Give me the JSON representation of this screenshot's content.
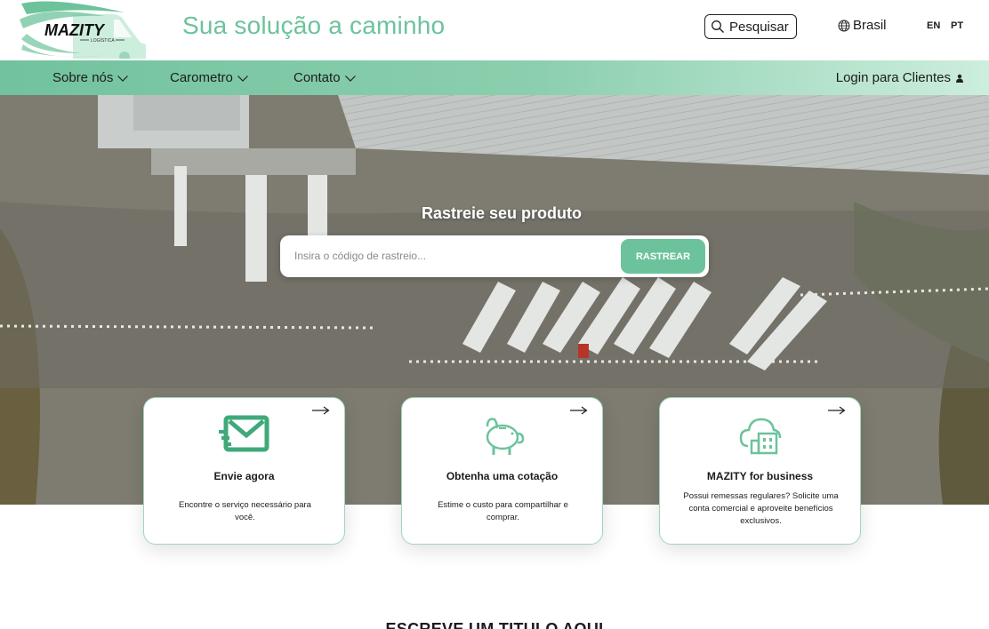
{
  "header": {
    "logo_text": "MAZITY",
    "logo_subtext": "LOGÍSTICA",
    "tagline": "Sua solução a caminho",
    "search_label": "Pesquisar",
    "region_label": "Brasil",
    "languages": [
      "EN",
      "PT"
    ]
  },
  "nav": {
    "items": [
      {
        "label": "Sobre nós"
      },
      {
        "label": "Carometro"
      },
      {
        "label": "Contato"
      }
    ],
    "login_label": "Login para Clientes"
  },
  "hero": {
    "title": "Rastreie seu produto",
    "input_placeholder": "Insira o código de rastreio...",
    "button_label": "RASTREAR"
  },
  "cards": [
    {
      "title": "Envie agora",
      "description": "Encontre o serviço necessário para você.",
      "icon": "mail-send-icon"
    },
    {
      "title": "Obtenha uma cotação",
      "description": "Estime o custo para compartilhar e comprar.",
      "icon": "piggy-bank-icon"
    },
    {
      "title": "MAZITY for business",
      "description": "Possui remessas regulares? Solicite uma conta comercial e aproveite benefícios exclusivos.",
      "icon": "cloud-building-icon"
    }
  ],
  "section": {
    "title": "ESCREVE UM TITULO AQUI"
  },
  "colors": {
    "accent": "#6cc39b",
    "text": "#1c1c1c",
    "card_border": "#9fd6bc"
  }
}
